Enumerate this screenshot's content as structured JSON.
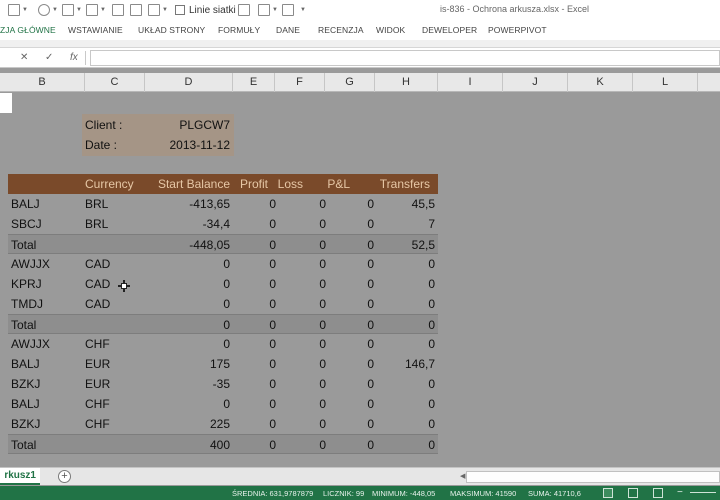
{
  "window": {
    "title": "is-836 - Ochrona arkusza.xlsx - Excel"
  },
  "quick_access": {
    "gridlines_label": "Linie siatki"
  },
  "ribbon_tabs": [
    "ZJA GŁÓWNE",
    "WSTAWIANIE",
    "UKŁAD STRONY",
    "FORMUŁY",
    "DANE",
    "RECENZJA",
    "WIDOK",
    "DEWELOPER",
    "POWERPIVOT"
  ],
  "formula_bar": {
    "cancel": "✕",
    "confirm": "✓",
    "fx": "fx",
    "value": ""
  },
  "columns": [
    "B",
    "C",
    "D",
    "E",
    "F",
    "G",
    "H",
    "I",
    "J",
    "K",
    "L"
  ],
  "info": {
    "client_label": "Client :",
    "client_value": "PLGCW7",
    "date_label": "Date :",
    "date_value": "2013-11-12"
  },
  "table": {
    "headers": [
      "",
      "Currency",
      "Start Balance",
      "Profit",
      "Loss",
      "P&L",
      "Transfers"
    ],
    "rows": [
      {
        "name": "BALJ",
        "currency": "BRL",
        "start": "-413,65",
        "profit": "0",
        "loss": "0",
        "pnl": "0",
        "transfers": "45,5"
      },
      {
        "name": "SBCJ",
        "currency": "BRL",
        "start": "-34,4",
        "profit": "0",
        "loss": "0",
        "pnl": "0",
        "transfers": "7"
      },
      {
        "name": "Total",
        "currency": "",
        "start": "-448,05",
        "profit": "0",
        "loss": "0",
        "pnl": "0",
        "transfers": "52,5",
        "total": true
      },
      {
        "name": "AWJJX",
        "currency": "CAD",
        "start": "0",
        "profit": "0",
        "loss": "0",
        "pnl": "0",
        "transfers": "0"
      },
      {
        "name": "KPRJ",
        "currency": "CAD",
        "start": "0",
        "profit": "0",
        "loss": "0",
        "pnl": "0",
        "transfers": "0"
      },
      {
        "name": "TMDJ",
        "currency": "CAD",
        "start": "0",
        "profit": "0",
        "loss": "0",
        "pnl": "0",
        "transfers": "0"
      },
      {
        "name": "Total",
        "currency": "",
        "start": "0",
        "profit": "0",
        "loss": "0",
        "pnl": "0",
        "transfers": "0",
        "total": true
      },
      {
        "name": "AWJJX",
        "currency": "CHF",
        "start": "0",
        "profit": "0",
        "loss": "0",
        "pnl": "0",
        "transfers": "0"
      },
      {
        "name": "BALJ",
        "currency": "EUR",
        "start": "175",
        "profit": "0",
        "loss": "0",
        "pnl": "0",
        "transfers": "146,7"
      },
      {
        "name": "BZKJ",
        "currency": "EUR",
        "start": "-35",
        "profit": "0",
        "loss": "0",
        "pnl": "0",
        "transfers": "0"
      },
      {
        "name": "BALJ",
        "currency": "CHF",
        "start": "0",
        "profit": "0",
        "loss": "0",
        "pnl": "0",
        "transfers": "0"
      },
      {
        "name": "BZKJ",
        "currency": "CHF",
        "start": "225",
        "profit": "0",
        "loss": "0",
        "pnl": "0",
        "transfers": "0"
      },
      {
        "name": "Total",
        "currency": "",
        "start": "400",
        "profit": "0",
        "loss": "0",
        "pnl": "0",
        "transfers": "0",
        "total": true
      }
    ]
  },
  "sheet_tabs": {
    "active": "rkusz1",
    "add": "+"
  },
  "status": {
    "average": "ŚREDNIA: 631,9787879",
    "count": "LICZNIK: 99",
    "minimum": "MINIMUM: -448,05",
    "maximum": "MAKSIMUM: 41590",
    "sum": "SUMA: 41710,6"
  },
  "colors": {
    "accent": "#217346",
    "header_fill": "#7a4a2a",
    "header_text": "#e6c7a6",
    "info_fill": "#a59586",
    "sheet_dim": "#9a9a9a"
  }
}
